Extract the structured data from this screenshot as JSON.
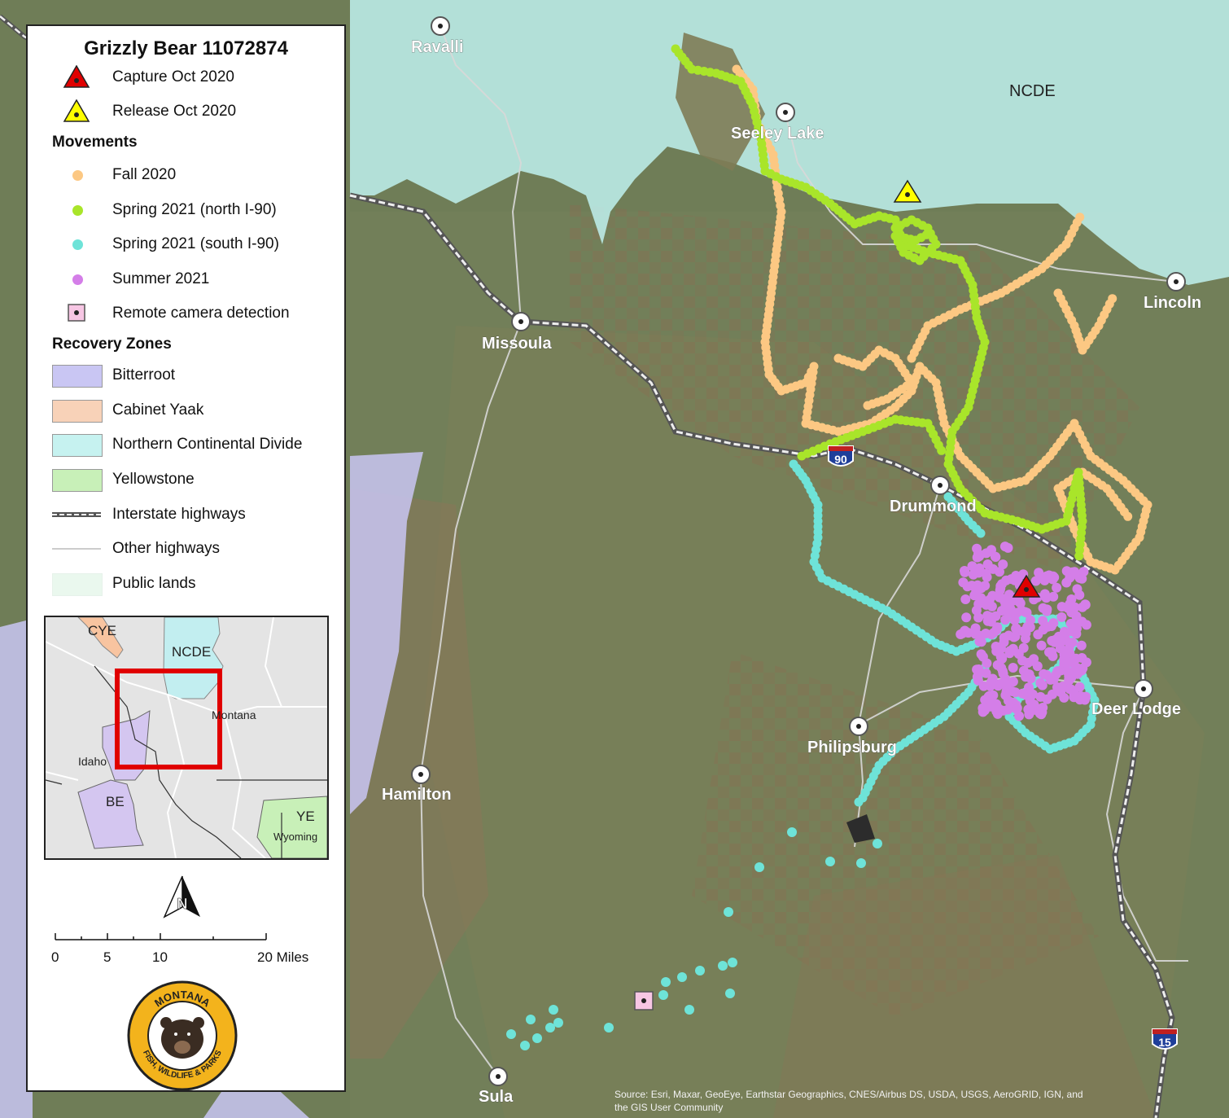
{
  "title": "Grizzly Bear 11072874",
  "legend": {
    "capture_label": "Capture Oct 2020",
    "release_label": "Release Oct 2020",
    "movements_heading": "Movements",
    "fall_label": "Fall 2020",
    "spring_north_label": "Spring 2021 (north I-90)",
    "spring_south_label": "Spring 2021 (south I-90)",
    "summer_label": "Summer 2021",
    "camera_label": "Remote camera detection",
    "zones_heading": "Recovery Zones",
    "bitterroot_label": "Bitterroot",
    "cabinet_label": "Cabinet Yaak",
    "ncd_label": "Northern Continental Divide",
    "yellowstone_label": "Yellowstone",
    "interstate_label": "Interstate highways",
    "other_hwy_label": "Other highways",
    "public_lands_label": "Public lands"
  },
  "colors": {
    "fall": "#fcc883",
    "spring_north": "#a9e52a",
    "spring_south": "#6ee3d8",
    "summer": "#d47ee8",
    "bitterroot": "#c9c6f3",
    "cabinet": "#f8d2b8",
    "ncd": "#c6f2f0",
    "yellowstone": "#c8f0b8",
    "public_lands": "#eaf8ee",
    "capture": "#e00000",
    "release": "#ffff00",
    "camera": "#f7c6e4"
  },
  "map": {
    "cities": [
      "Ravalli",
      "Seeley Lake",
      "Missoula",
      "Lincoln",
      "Drummond",
      "Deer Lodge",
      "Philipsburg",
      "Hamilton",
      "Sula"
    ],
    "ncde_label": "NCDE",
    "interstate_shields": [
      "90",
      "15"
    ],
    "attribution_line1": "Source: Esri, Maxar, GeoEye, Earthstar Geographics, CNES/Airbus DS, USDA, USGS, AeroGRID, IGN, and",
    "attribution_line2": "the GIS User Community"
  },
  "inset": {
    "labels": [
      "CYE",
      "NCDE",
      "Montana",
      "Idaho",
      "BE",
      "YE",
      "Wyoming"
    ]
  },
  "north_arrow": "N",
  "scale": {
    "ticks": [
      "0",
      "5",
      "10",
      "20 Miles"
    ]
  },
  "logo": {
    "top_text": "MONTANA",
    "bottom_text": "FISH, WILDLIFE & PARKS"
  }
}
